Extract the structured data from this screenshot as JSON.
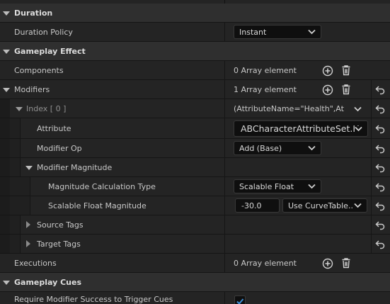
{
  "categories": {
    "duration": "Duration",
    "gameplay_effect": "Gameplay Effect",
    "gameplay_cues": "Gameplay Cues"
  },
  "rows": {
    "duration_policy": {
      "label": "Duration Policy",
      "value": "Instant"
    },
    "components": {
      "label": "Components",
      "value": "0 Array element"
    },
    "modifiers": {
      "label": "Modifiers",
      "value": "1 Array element"
    },
    "index": {
      "label": "Index",
      "index_tag": "[ 0 ]",
      "value": "(AttributeName=\"Health\",Attrib"
    },
    "attribute": {
      "label": "Attribute",
      "value": "ABCharacterAttributeSet.H"
    },
    "modifier_op": {
      "label": "Modifier Op",
      "value": "Add (Base)"
    },
    "modifier_magnitude": {
      "label": "Modifier Magnitude"
    },
    "magnitude_calc_type": {
      "label": "Magnitude Calculation Type",
      "value": "Scalable Float"
    },
    "scalable_float_magnitude": {
      "label": "Scalable Float Magnitude",
      "value": "-30.0",
      "curve": "Use CurveTable..."
    },
    "source_tags": {
      "label": "Source Tags"
    },
    "target_tags": {
      "label": "Target Tags"
    },
    "executions": {
      "label": "Executions",
      "value": "0 Array element"
    },
    "require_modifier_success": {
      "label": "Require Modifier Success to Trigger Cues",
      "checked": true
    }
  },
  "icons": {
    "add": "plus-circle-icon",
    "delete": "trash-icon",
    "reset": "reset-to-default-icon",
    "expand": "triangle-down-icon",
    "collapse": "triangle-right-icon",
    "dropdown": "chevron-down-icon"
  }
}
